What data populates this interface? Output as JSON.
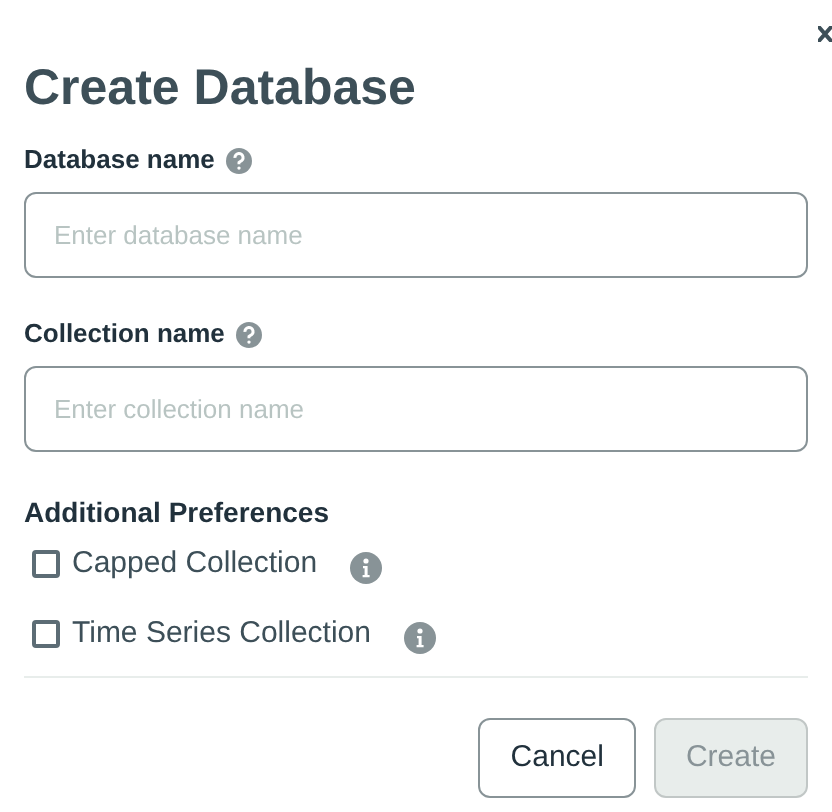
{
  "dialog": {
    "title": "Create Database"
  },
  "fields": [
    {
      "label": "Database name",
      "placeholder": "Enter database name"
    },
    {
      "label": "Collection name",
      "placeholder": "Enter collection name"
    }
  ],
  "preferences": {
    "heading": "Additional Preferences",
    "options": [
      {
        "label": "Capped Collection",
        "checked": false
      },
      {
        "label": "Time Series Collection",
        "checked": false
      }
    ]
  },
  "buttons": [
    {
      "label": "Cancel",
      "disabled": false
    },
    {
      "label": "Create",
      "disabled": true
    }
  ]
}
